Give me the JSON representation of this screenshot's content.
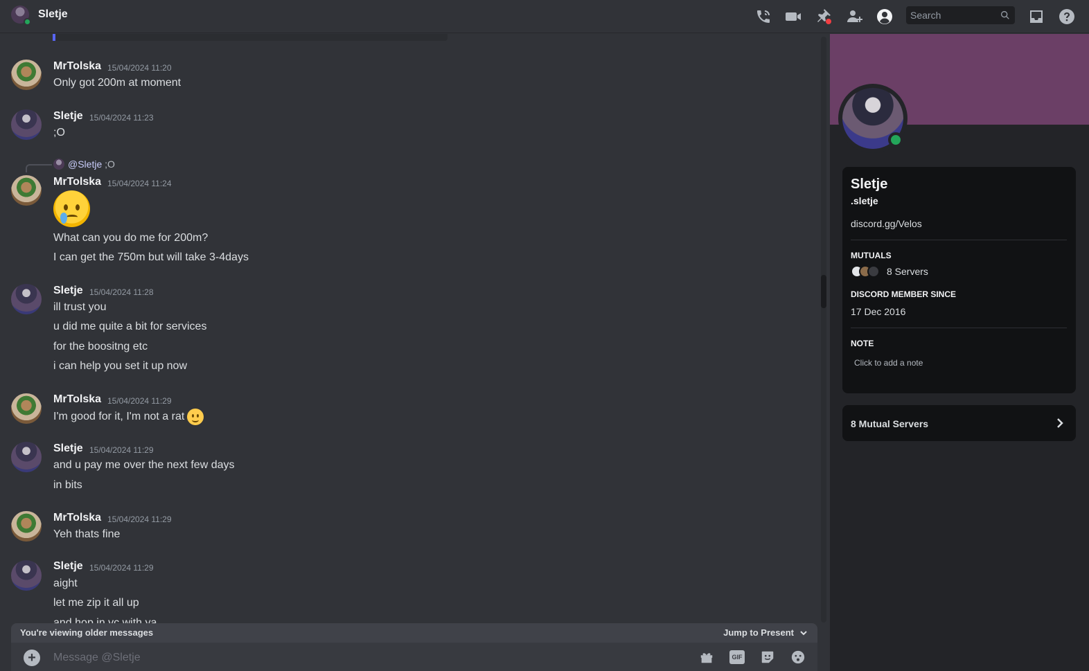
{
  "header": {
    "title": "Sletje",
    "search_placeholder": "Search",
    "icons": [
      "call-icon",
      "video-call-icon",
      "pinned-messages-icon",
      "add-friends-icon",
      "user-profile-icon",
      "inbox-icon",
      "help-icon"
    ]
  },
  "messages": [
    {
      "user": "MrTolska",
      "time": "15/04/2024 11:20",
      "lines": [
        "Only got 200m at moment"
      ]
    },
    {
      "user": "Sletje",
      "time": "15/04/2024 11:23",
      "lines": [
        ";O"
      ]
    },
    {
      "user": "MrTolska",
      "time": "15/04/2024 11:24",
      "reply": {
        "mention": "@Sletje",
        "text": ";O"
      },
      "emoji": "crying-face",
      "lines": [
        "What can you do me for 200m?",
        "I can get the 750m but will take 3-4days"
      ]
    },
    {
      "user": "Sletje",
      "time": "15/04/2024 11:28",
      "lines": [
        "ill trust you",
        "u did me quite a bit for services",
        "for the boositng etc",
        "i can help you set it up now"
      ]
    },
    {
      "user": "MrTolska",
      "time": "15/04/2024 11:29",
      "lines": [
        "I'm good for it, I'm not a rat"
      ],
      "trailing_emoji": "slightly-smiling-face"
    },
    {
      "user": "Sletje",
      "time": "15/04/2024 11:29",
      "lines": [
        "and u pay me over the next few days",
        "in bits"
      ]
    },
    {
      "user": "MrTolska",
      "time": "15/04/2024 11:29",
      "lines": [
        "Yeh thats fine"
      ]
    },
    {
      "user": "Sletje",
      "time": "15/04/2024 11:29",
      "lines": [
        "aight",
        "let me zip it all up",
        "and hop in vc with ya"
      ]
    }
  ],
  "older_bar": {
    "text": "You're viewing older messages",
    "jump_label": "Jump to Present"
  },
  "composer": {
    "placeholder": "Message @Sletje",
    "gif_label": "GIF"
  },
  "profile": {
    "display_name": "Sletje",
    "username": ".sletje",
    "bio_link": "discord.gg/Velos",
    "mutuals_title": "MUTUALS",
    "mutuals_text": "8 Servers",
    "member_since_title": "DISCORD MEMBER SINCE",
    "member_since": "17 Dec 2016",
    "note_title": "NOTE",
    "note_placeholder": "Click to add a note",
    "mutual_servers_label": "8 Mutual Servers",
    "banner_color": "#6b3f66",
    "status_color": "#23a55a"
  },
  "colors": {
    "accent": "#5865f2",
    "bg": "#313338",
    "panel": "#232428",
    "card": "#111214"
  }
}
